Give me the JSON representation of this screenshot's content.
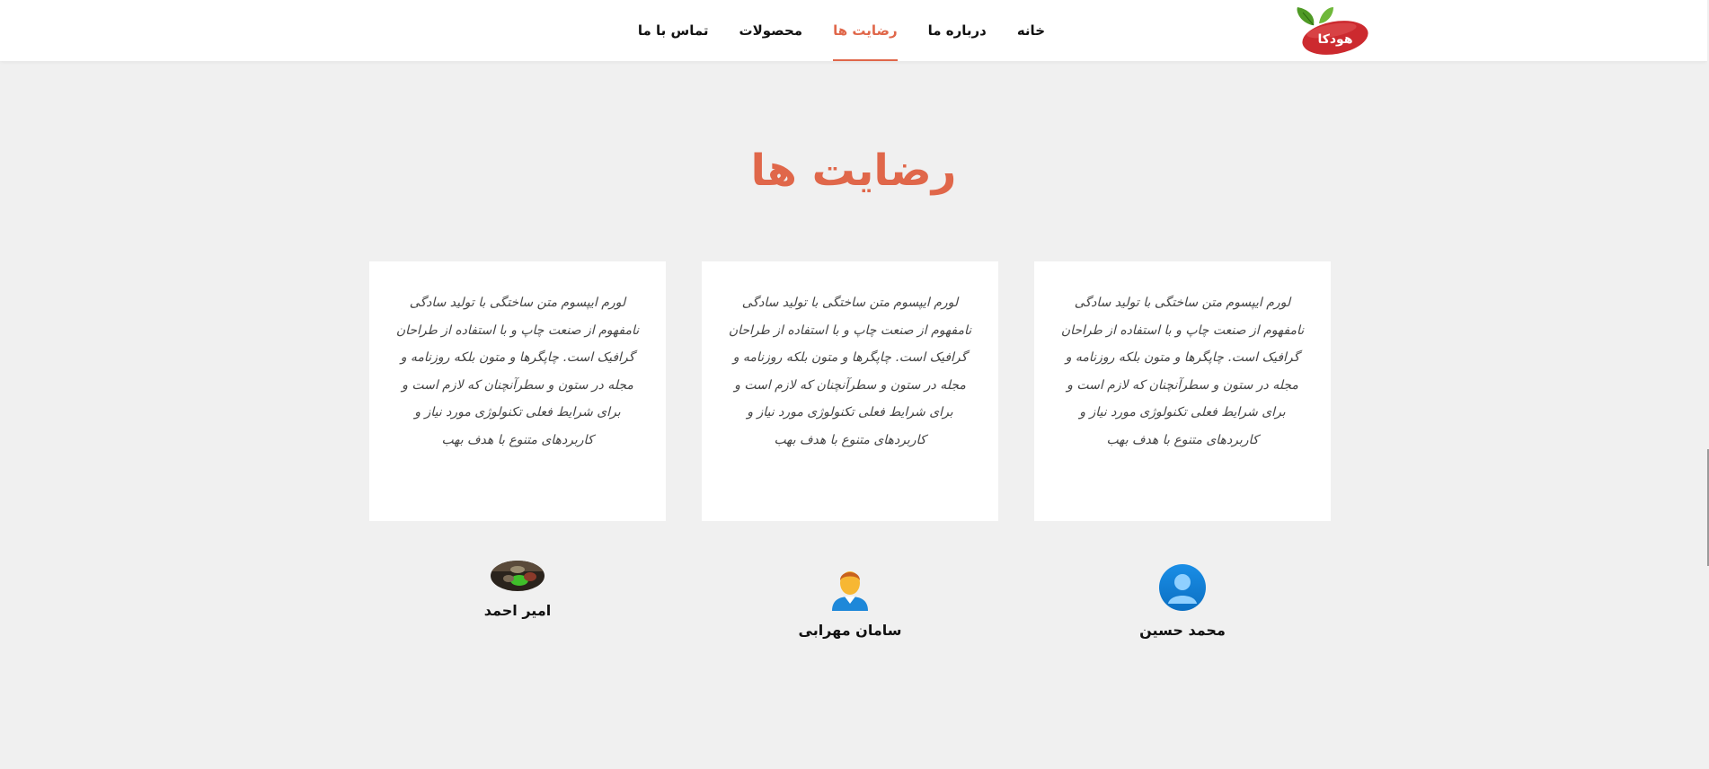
{
  "brand": {
    "logo_text": "هودکا",
    "colors": {
      "accent": "#e0674a",
      "logo_red": "#cc2a2f",
      "leaf_green": "#4f9a25"
    }
  },
  "nav": {
    "items": [
      {
        "label": "خانه",
        "active": false
      },
      {
        "label": "درباره ما",
        "active": false
      },
      {
        "label": "رضایت ها",
        "active": true
      },
      {
        "label": "محصولات",
        "active": false
      },
      {
        "label": "تماس با ما",
        "active": false
      }
    ]
  },
  "section": {
    "title": "رضایت ها"
  },
  "testimonials": [
    {
      "text": "لورم ایپسوم متن ساختگی با تولید سادگی نامفهوم از صنعت چاپ و با استفاده از طراحان گرافیک است. چاپگرها و متون بلکه روزنامه و مجله در ستون و سطرآنچنان که لازم است و برای شرایط فعلی تکنولوژی مورد نیاز و کاربردهای متنوع با هدف بهب",
      "name": "محمد حسین",
      "avatar": "default-user-icon"
    },
    {
      "text": "لورم ایپسوم متن ساختگی با تولید سادگی نامفهوم از صنعت چاپ و با استفاده از طراحان گرافیک است. چاپگرها و متون بلکه روزنامه و مجله در ستون و سطرآنچنان که لازم است و برای شرایط فعلی تکنولوژی مورد نیاز و کاربردهای متنوع با هدف بهب",
      "name": "سامان مهرابی",
      "avatar": "man-avatar-icon"
    },
    {
      "text": "لورم ایپسوم متن ساختگی با تولید سادگی نامفهوم از صنعت چاپ و با استفاده از طراحان گرافیک است. چاپگرها و متون بلکه روزنامه و مجله در ستون و سطرآنچنان که لازم است و برای شرایط فعلی تکنولوژی مورد نیاز و کاربردهای متنوع با هدف بهب",
      "name": "امیر احمد",
      "avatar": "photo-avatar"
    }
  ]
}
